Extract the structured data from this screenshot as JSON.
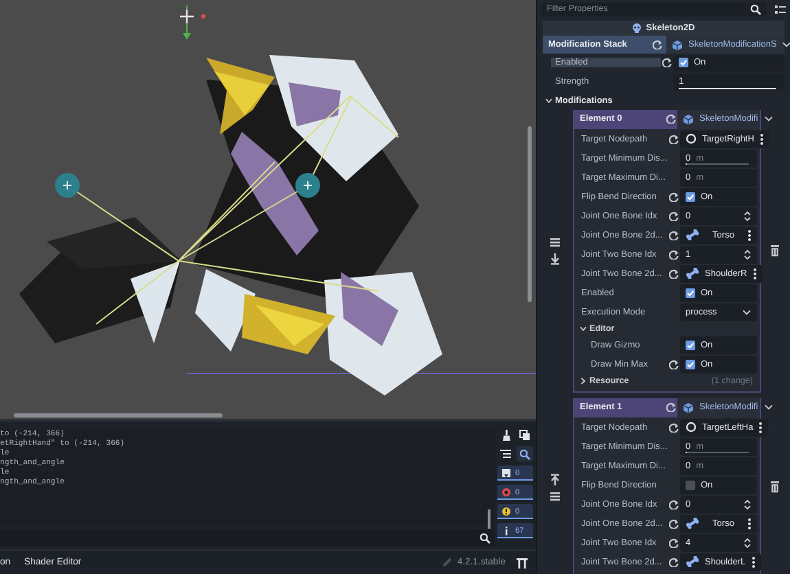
{
  "inspector": {
    "filter_placeholder": "Filter Properties",
    "node": "Skeleton2D",
    "stack": {
      "label": "Modification Stack",
      "value": "SkeletonModificationS"
    },
    "rows": [
      {
        "kind": "check",
        "label": "Enabled",
        "revert": true,
        "checked": true,
        "value": "On"
      },
      {
        "kind": "slider",
        "label": "Strength",
        "revert": false,
        "value": "1",
        "level": 1
      }
    ],
    "section": {
      "label": "Modifications",
      "expanded": true
    },
    "elements": [
      {
        "label": "Element 0",
        "value": "SkeletonModifi",
        "rows": [
          {
            "kind": "node",
            "label": "Target Nodepath",
            "revert": true,
            "value": "TargetRightH"
          },
          {
            "kind": "slider",
            "label": "Target Minimum Dis...",
            "revert": false,
            "value": "0",
            "unit": "m",
            "level": 0
          },
          {
            "kind": "number",
            "label": "Target Maximum Di...",
            "revert": false,
            "value": "0",
            "unit": "m"
          },
          {
            "kind": "check",
            "label": "Flip Bend Direction",
            "revert": true,
            "checked": true,
            "value": "On"
          },
          {
            "kind": "spin",
            "label": "Joint One Bone Idx",
            "revert": true,
            "value": "0"
          },
          {
            "kind": "bone",
            "label": "Joint One Bone 2d...",
            "revert": true,
            "value": "Torso"
          },
          {
            "kind": "spin",
            "label": "Joint Two Bone Idx",
            "revert": true,
            "value": "1"
          },
          {
            "kind": "bone",
            "label": "Joint Two Bone 2d...",
            "revert": true,
            "value": "ShoulderR"
          },
          {
            "kind": "check",
            "label": "Enabled",
            "revert": false,
            "checked": true,
            "value": "On"
          },
          {
            "kind": "enum",
            "label": "Execution Mode",
            "revert": false,
            "value": "process"
          }
        ],
        "groups": [
          {
            "label": "Editor",
            "expanded": true,
            "rows": [
              {
                "kind": "check",
                "label": "Draw Gizmo",
                "revert": false,
                "checked": true,
                "value": "On"
              },
              {
                "kind": "check",
                "label": "Draw Min Max",
                "revert": true,
                "checked": true,
                "value": "On"
              }
            ]
          },
          {
            "label": "Resource",
            "expanded": false,
            "note": "(1 change)"
          }
        ]
      },
      {
        "label": "Element 1",
        "value": "SkeletonModifi",
        "rows": [
          {
            "kind": "node",
            "label": "Target Nodepath",
            "revert": true,
            "value": "TargetLeftHa"
          },
          {
            "kind": "slider",
            "label": "Target Minimum Dis...",
            "revert": false,
            "value": "0",
            "unit": "m",
            "level": 0
          },
          {
            "kind": "number",
            "label": "Target Maximum Di...",
            "revert": false,
            "value": "0",
            "unit": "m"
          },
          {
            "kind": "check",
            "label": "Flip Bend Direction",
            "revert": false,
            "checked": false,
            "value": "On"
          },
          {
            "kind": "spin",
            "label": "Joint One Bone Idx",
            "revert": true,
            "value": "0"
          },
          {
            "kind": "bone",
            "label": "Joint One Bone 2d...",
            "revert": true,
            "value": "Torso"
          },
          {
            "kind": "spin",
            "label": "Joint Two Bone Idx",
            "revert": true,
            "value": "4"
          },
          {
            "kind": "bone",
            "label": "Joint Two Bone 2d...",
            "revert": true,
            "value": "ShoulderL"
          }
        ]
      }
    ]
  },
  "output": {
    "lines": [
      "to (-214, 366)",
      "etRightHand\" to (-214, 366)",
      "le",
      "ngth_and_angle",
      "le",
      "ngth_and_angle"
    ],
    "search_on": true,
    "filters": [
      {
        "kind": "message",
        "count": "0",
        "on": true
      },
      {
        "kind": "error",
        "count": "0",
        "on": true
      },
      {
        "kind": "warning",
        "count": "0",
        "on": true
      },
      {
        "kind": "info",
        "count": "67",
        "on": true
      }
    ]
  },
  "status_bar": {
    "tabs": [
      "on",
      "Shader Editor"
    ],
    "version": "4.2.1.stable"
  }
}
